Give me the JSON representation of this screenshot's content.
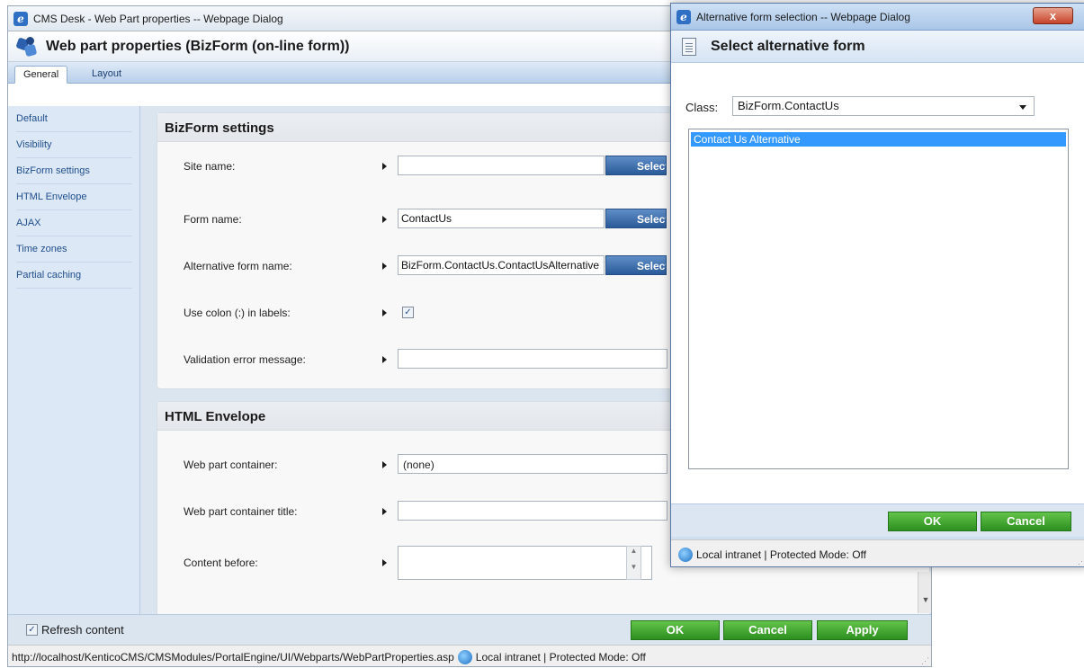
{
  "main_window": {
    "title": "CMS Desk - Web Part properties -- Webpage Dialog",
    "header_title": "Web part properties (BizForm (on-line form))",
    "tabs": [
      {
        "label": "General",
        "active": true
      },
      {
        "label": "Layout",
        "active": false
      }
    ],
    "sidebar": [
      {
        "label": "Default"
      },
      {
        "label": "Visibility"
      },
      {
        "label": "BizForm settings"
      },
      {
        "label": "HTML Envelope"
      },
      {
        "label": "AJAX"
      },
      {
        "label": "Time zones"
      },
      {
        "label": "Partial caching"
      }
    ],
    "bizform_panel": {
      "title": "BizForm settings",
      "site_name": {
        "label": "Site name:",
        "value": "",
        "button": "Select"
      },
      "form_name": {
        "label": "Form name:",
        "value": "ContactUs",
        "button": "Select"
      },
      "alt_form_name": {
        "label": "Alternative form name:",
        "value": "BizForm.ContactUs.ContactUsAlternative",
        "button": "Select"
      },
      "use_colon": {
        "label": "Use colon (:) in labels:",
        "checked": true
      },
      "validation_error": {
        "label": "Validation error message:",
        "value": ""
      }
    },
    "envelope_panel": {
      "title": "HTML Envelope",
      "container": {
        "label": "Web part container:",
        "value": "(none)"
      },
      "container_title": {
        "label": "Web part container title:",
        "value": ""
      },
      "content_before": {
        "label": "Content before:",
        "value": ""
      }
    },
    "footer": {
      "refresh_label": "Refresh content",
      "refresh_checked": true,
      "ok": "OK",
      "cancel": "Cancel",
      "apply": "Apply"
    },
    "status": {
      "url": "http://localhost/KenticoCMS/CMSModules/PortalEngine/UI/Webparts/WebPartProperties.asp",
      "zone": "Local intranet | Protected Mode: Off"
    }
  },
  "dialog": {
    "title": "Alternative form selection -- Webpage Dialog",
    "close": "x",
    "header_title": "Select alternative form",
    "class_label": "Class:",
    "class_value": "BizForm.ContactUs",
    "list_items": [
      "Contact Us Alternative"
    ],
    "ok": "OK",
    "cancel": "Cancel",
    "status": "Local intranet | Protected Mode: Off"
  },
  "icons": {
    "browser": "ie-icon",
    "webpart": "webpart-icon",
    "zone": "globe-icon",
    "form": "document-icon"
  },
  "colors": {
    "green_button": "#3aa52a",
    "blue_button": "#2a5a99",
    "selection": "#3399ff",
    "sidebar_bg": "#dce8f5"
  }
}
